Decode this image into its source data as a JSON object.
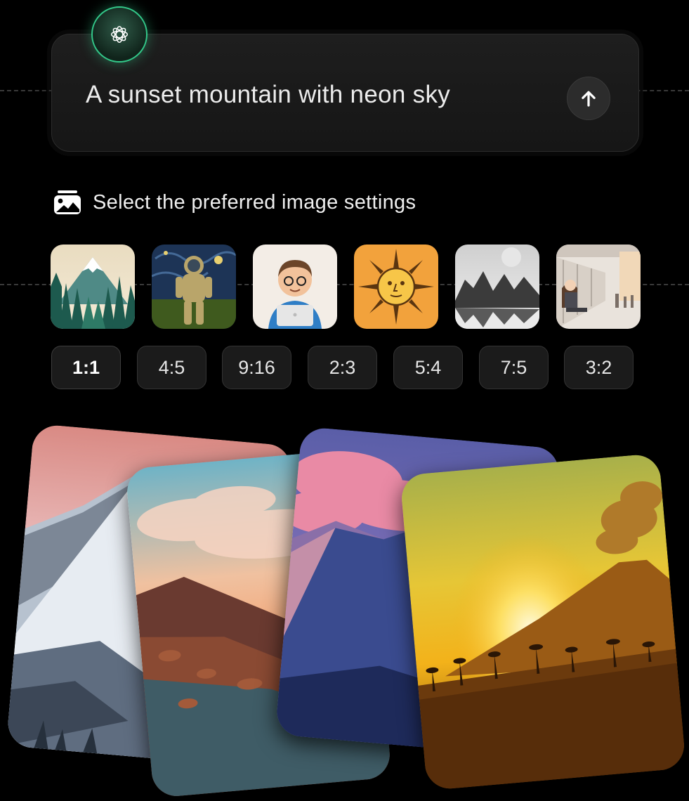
{
  "prompt": {
    "text": "A sunset mountain with neon sky",
    "send_icon": "arrow-up-icon",
    "logo_icon": "flower-logo-icon",
    "accent_color": "#33c98a"
  },
  "settings": {
    "heading": "Select the preferred image settings",
    "heading_icon": "image-stack-icon"
  },
  "styles": [
    {
      "name": "forest-mountain"
    },
    {
      "name": "astronaut-painting"
    },
    {
      "name": "cartoon-boy-laptop"
    },
    {
      "name": "sun-illustration"
    },
    {
      "name": "monochrome-mountains"
    },
    {
      "name": "anime-train-station"
    }
  ],
  "ratios": [
    "1:1",
    "4:5",
    "9:16",
    "2:3",
    "5:4",
    "7:5",
    "3:2"
  ],
  "selected_ratio": "1:1",
  "results": [
    {
      "name": "snowy-peak-pink-sky"
    },
    {
      "name": "hill-sunset-clouds"
    },
    {
      "name": "purple-mountain-clouds"
    },
    {
      "name": "volcano-golden-sunset"
    }
  ]
}
